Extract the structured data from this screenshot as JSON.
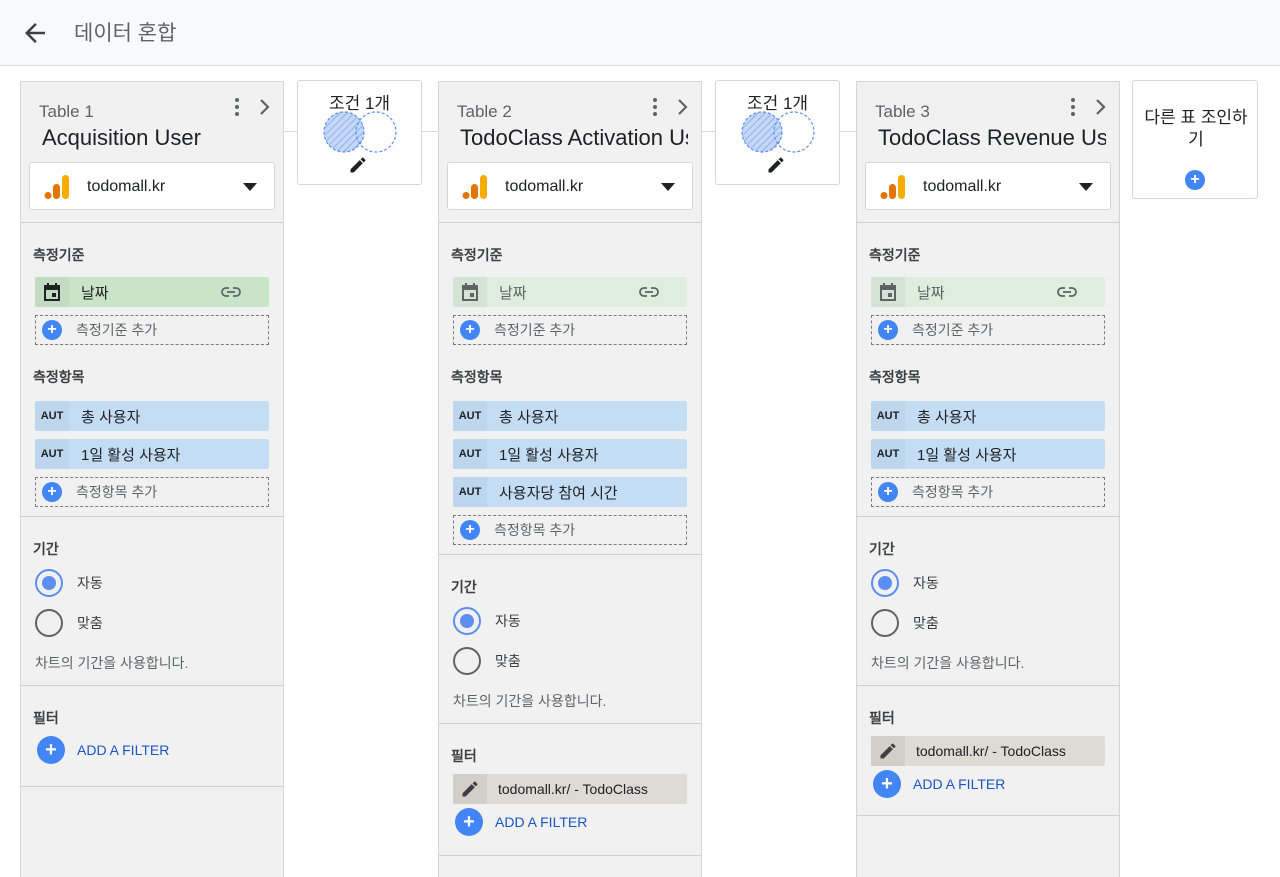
{
  "header": {
    "title": "데이터 혼합"
  },
  "joins": [
    {
      "label": "조건 1개"
    },
    {
      "label": "조건 1개"
    }
  ],
  "add_table": {
    "label": "다른 표 조인하기"
  },
  "common": {
    "dimension_section": "측정기준",
    "metric_section": "측정항목",
    "add_dimension": "측정기준 추가",
    "add_metric": "측정항목 추가",
    "period_section": "기간",
    "period_auto": "자동",
    "period_custom": "맞춤",
    "period_note": "차트의 기간을 사용합니다.",
    "filter_section": "필터",
    "add_filter": "ADD A FILTER",
    "metric_badge": "AUT"
  },
  "tables": [
    {
      "label": "Table 1",
      "name": "Acquisition User",
      "source": "todomall.kr",
      "dimension": "날짜",
      "metrics": [
        "총 사용자",
        "1일 활성 사용자"
      ],
      "filter": ""
    },
    {
      "label": "Table 2",
      "name": "TodoClass Activation User",
      "source": "todomall.kr",
      "dimension": "날짜",
      "metrics": [
        "총 사용자",
        "1일 활성 사용자",
        "사용자당 참여 시간"
      ],
      "filter": "todomall.kr/ - TodoClass"
    },
    {
      "label": "Table 3",
      "name": "TodoClass Revenue User",
      "source": "todomall.kr",
      "dimension": "날짜",
      "metrics": [
        "총 사용자",
        "1일 활성 사용자"
      ],
      "filter": "todomall.kr/ - TodoClass"
    }
  ],
  "colors": {
    "accent": "#4285f4",
    "dimension_chip": "#c9e5c9",
    "metric_chip": "#c4ddf5",
    "filter_chip": "#dedad5",
    "link": "#1a56c8"
  }
}
